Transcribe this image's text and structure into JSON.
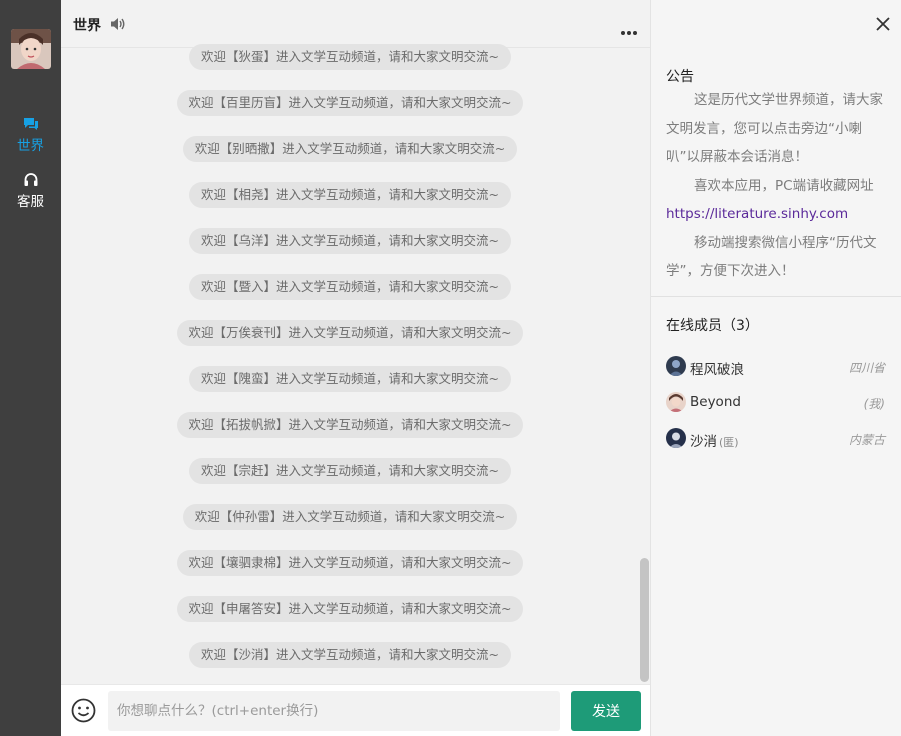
{
  "rail": {
    "items": [
      {
        "label": "世界",
        "icon": "chat-bubble-icon",
        "active": true
      },
      {
        "label": "客服",
        "icon": "headset-icon",
        "active": false
      }
    ],
    "accent_color": "#17a1e4"
  },
  "chat": {
    "title": "世界",
    "messages": [
      "欢迎【狄蛋】进入文学互动频道，请和大家文明交流~",
      "欢迎【百里历盲】进入文学互动频道，请和大家文明交流~",
      "欢迎【别晒撒】进入文学互动频道，请和大家文明交流~",
      "欢迎【相尧】进入文学互动频道，请和大家文明交流~",
      "欢迎【乌洋】进入文学互动频道，请和大家文明交流~",
      "欢迎【暨入】进入文学互动频道，请和大家文明交流~",
      "欢迎【万俟衰刊】进入文学互动频道，请和大家文明交流~",
      "欢迎【隗蛮】进入文学互动频道，请和大家文明交流~",
      "欢迎【拓拔帆掀】进入文学互动频道，请和大家文明交流~",
      "欢迎【宗赶】进入文学互动频道，请和大家文明交流~",
      "欢迎【仲孙雷】进入文学互动频道，请和大家文明交流~",
      "欢迎【壤驷隶棉】进入文学互动频道，请和大家文明交流~",
      "欢迎【申屠答安】进入文学互动频道，请和大家文明交流~",
      "欢迎【沙消】进入文学互动频道，请和大家文明交流~"
    ],
    "input_placeholder": "你想聊点什么？(ctrl+enter换行)",
    "input_value": "",
    "send_label": "发送",
    "send_color": "#1e9b78"
  },
  "side": {
    "announcement_title": "公告",
    "announcement": {
      "p1": "这是历代文学世界频道，请大家文明发言，您可以点击旁边“小喇叭”以屏蔽本会话消息！",
      "p2": "喜欢本应用，PC端请收藏网址",
      "link": "https://literature.sinhy.com",
      "p3": "移动端搜索微信小程序“历代文学”，方便下次进入！"
    },
    "members_title": "在线成员（3）",
    "members": [
      {
        "name": "程风破浪",
        "tag": "",
        "location": "四川省"
      },
      {
        "name": "Beyond",
        "tag": "",
        "location": "(我)"
      },
      {
        "name": "沙消",
        "tag": "(匿)",
        "location": "内蒙古"
      }
    ]
  }
}
